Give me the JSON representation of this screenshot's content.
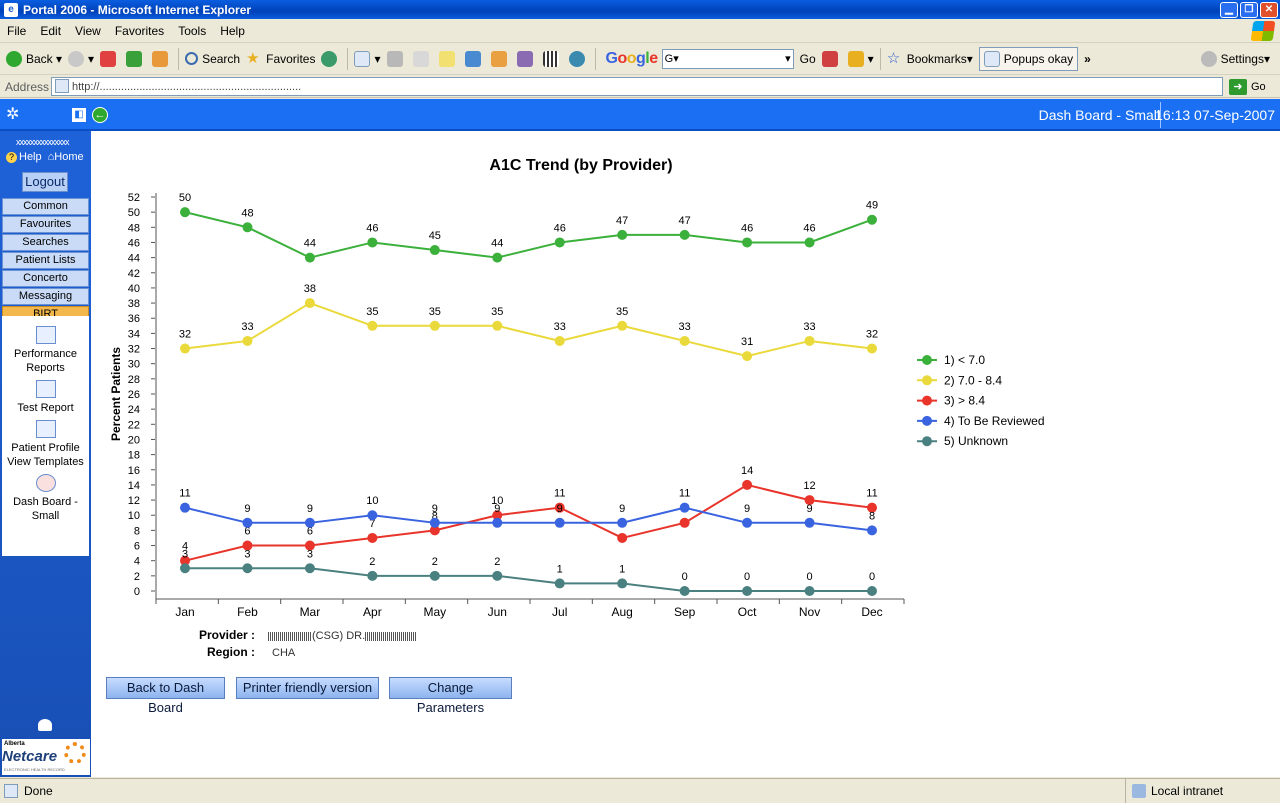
{
  "window": {
    "title": "Portal 2006 - Microsoft Internet Explorer"
  },
  "menu": [
    "File",
    "Edit",
    "View",
    "Favorites",
    "Tools",
    "Help"
  ],
  "toolbar": {
    "back": "Back",
    "search": "Search",
    "favorites": "Favorites",
    "google": "Google",
    "google_search_value": "G▾",
    "go": "Go",
    "bookmarks": "Bookmarks▾",
    "popups": "Popups okay",
    "chevron": "»",
    "settings": "Settings▾"
  },
  "address": {
    "label": "Address",
    "url": "http://..................................................................",
    "go": "Go"
  },
  "portal": {
    "dash_title": "Dash Board - Small",
    "timestamp": "16:13 07-Sep-2007",
    "user": "xxxxxxxxxxxxxxx",
    "help": "Help",
    "home": "Home",
    "logout": "Logout",
    "nav": [
      "Common",
      "Favourites",
      "Searches",
      "Patient Lists",
      "Concerto",
      "Messaging",
      "BIRT"
    ],
    "birt_items": [
      "Performance Reports",
      "Test Report",
      "Patient Profile View Templates",
      "Dash Board - Small"
    ],
    "netcare": {
      "alberta": "Alberta",
      "name": "Netcare",
      "tagline": "ELECTRONIC HEALTH RECORD"
    }
  },
  "provider_label": "Provider :",
  "provider_value": "(CSG) DR.",
  "region_label": "Region :",
  "region_value": "CHA",
  "buttons": [
    "Back to Dash Board",
    "Printer friendly version",
    "Change Parameters"
  ],
  "status": {
    "text": "Done",
    "zone": "Local intranet"
  },
  "chart_data": {
    "type": "line",
    "title": "A1C Trend (by Provider)",
    "xlabel": "",
    "ylabel": "Percent Patients",
    "ylim": [
      0,
      52
    ],
    "ystep": 2,
    "categories": [
      "Jan",
      "Feb",
      "Mar",
      "Apr",
      "May",
      "Jun",
      "Jul",
      "Aug",
      "Sep",
      "Oct",
      "Nov",
      "Dec"
    ],
    "legend_position": "right",
    "grid": false,
    "series": [
      {
        "name": "1) < 7.0",
        "color": "#3bb03b",
        "values": [
          50,
          48,
          44,
          46,
          45,
          44,
          46,
          47,
          47,
          46,
          46,
          49
        ]
      },
      {
        "name": "2) 7.0 - 8.4",
        "color": "#ead93a",
        "values": [
          32,
          33,
          38,
          35,
          35,
          35,
          33,
          35,
          33,
          31,
          33,
          32
        ]
      },
      {
        "name": "3) > 8.4",
        "color": "#e8342a",
        "values": [
          4,
          6,
          6,
          7,
          8,
          10,
          11,
          7,
          9,
          14,
          12,
          11
        ]
      },
      {
        "name": "4) To Be Reviewed",
        "color": "#3a63e0",
        "values": [
          11,
          9,
          9,
          10,
          9,
          9,
          9,
          9,
          11,
          9,
          9,
          8
        ]
      },
      {
        "name": "5) Unknown",
        "color": "#4a8080",
        "values": [
          3,
          3,
          3,
          2,
          2,
          2,
          1,
          1,
          0,
          0,
          0,
          0
        ]
      }
    ]
  }
}
